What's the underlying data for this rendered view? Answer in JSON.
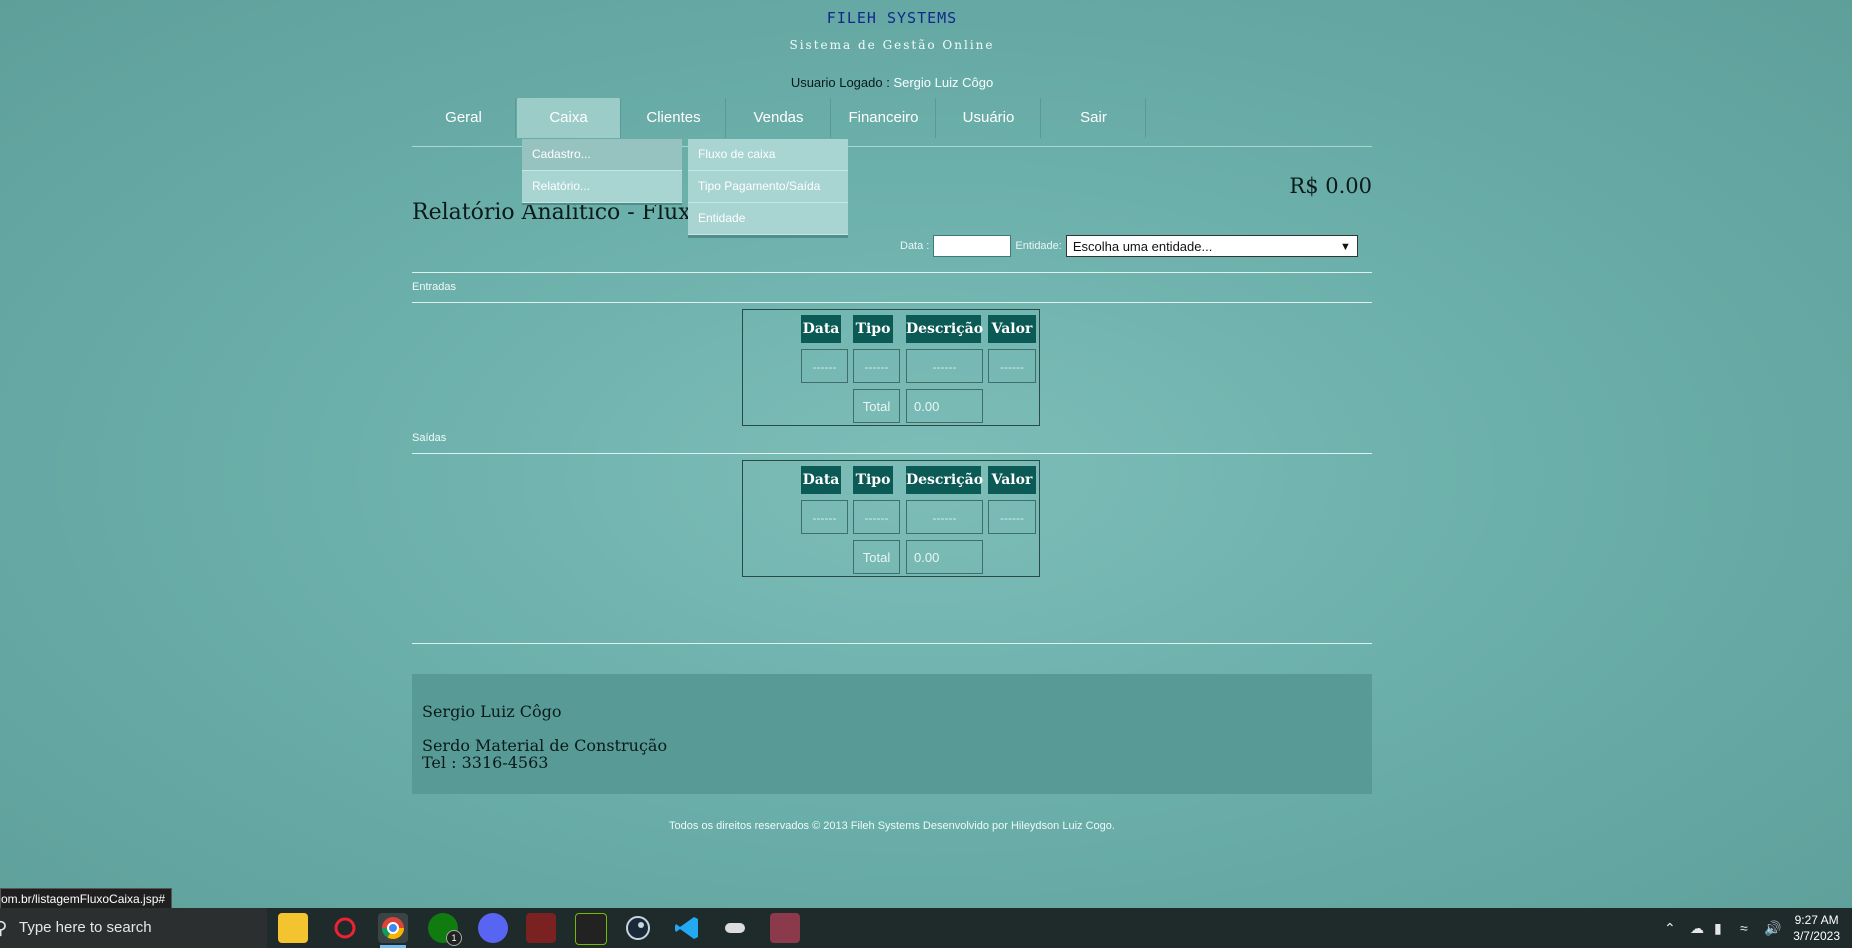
{
  "brand": {
    "title": "FILEH SYSTEMS",
    "subtitle": "Sistema de Gestão Online"
  },
  "user": {
    "label": "Usuario Logado :",
    "name": "Sergio Luiz Côgo"
  },
  "nav": {
    "tabs": [
      "Geral",
      "Caixa",
      "Clientes",
      "Vendas",
      "Financeiro",
      "Usuário",
      "Sair"
    ],
    "active": "Caixa"
  },
  "caixa_menu": {
    "items": [
      "Cadastro...",
      "Relatório..."
    ]
  },
  "cadastro_submenu": {
    "items": [
      "Fluxo de caixa",
      "Tipo Pagamento/Saída",
      "Entidade"
    ]
  },
  "balance": "R$ 0.00",
  "page_title": "Relatório Analítico - Fluxo p",
  "filters": {
    "date_label": "Data :",
    "date_value": "",
    "entity_label": "Entidade:",
    "entity_selected": "Escolha uma entidade..."
  },
  "entradas": {
    "label": "Entradas",
    "headers": [
      "Data",
      "Tipo",
      "Descrição",
      "Valor"
    ],
    "row": [
      "------",
      "------",
      "------",
      "------"
    ],
    "total_label": "Total",
    "total_value": "0.00"
  },
  "saidas": {
    "label": "Saídas",
    "headers": [
      "Data",
      "Tipo",
      "Descrição",
      "Valor"
    ],
    "row": [
      "------",
      "------",
      "------",
      "------"
    ],
    "total_label": "Total",
    "total_value": "0.00"
  },
  "footer": {
    "name": "Sergio Luiz Côgo",
    "company": "Serdo Material de Construção",
    "phone": "Tel : 3316-4563",
    "copyright": "Todos os direitos reservados © 2013 Fileh Systems Desenvolvido por Hileydson Luiz Cogo."
  },
  "status_url": "om.br/listagemFluxoCaixa.jsp#",
  "taskbar": {
    "search_placeholder": "Type here to search",
    "icons": [
      "file-explorer-icon",
      "game-app-icon",
      "chrome-icon",
      "xbox-icon",
      "discord-icon",
      "app-icon-1",
      "nvidia-icon",
      "steam-icon",
      "vscode-icon",
      "controller-icon",
      "avatar-app-icon"
    ],
    "xbox_badge": "1",
    "time": "9:27 AM",
    "date": "3/7/2023"
  }
}
